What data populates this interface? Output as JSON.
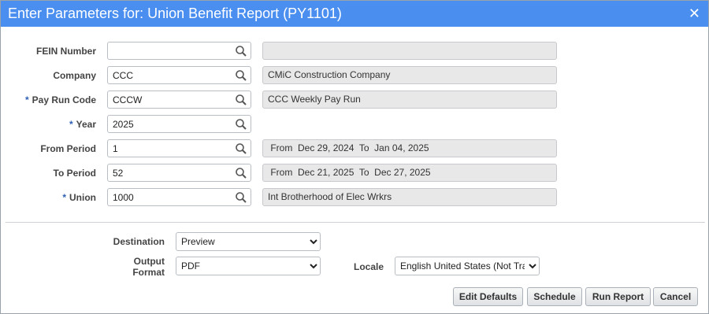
{
  "dialog": {
    "title": "Enter Parameters for: Union Benefit Report (PY1101)",
    "close_label": "✕"
  },
  "fields": [
    {
      "label": "FEIN Number",
      "required": false,
      "value": "",
      "description": ""
    },
    {
      "label": "Company",
      "required": false,
      "value": "CCC",
      "description": "CMiC Construction Company"
    },
    {
      "label": "Pay Run Code",
      "required": true,
      "value": "CCCW",
      "description": "CCC Weekly Pay Run"
    },
    {
      "label": "Year",
      "required": true,
      "value": "2025",
      "description": null
    },
    {
      "label": "From Period",
      "required": false,
      "value": "1",
      "description": " From  Dec 29, 2024  To  Jan 04, 2025"
    },
    {
      "label": "To Period",
      "required": false,
      "value": "52",
      "description": " From  Dec 21, 2025  To  Dec 27, 2025"
    },
    {
      "label": "Union",
      "required": true,
      "value": "1000",
      "description": "Int Brotherhood of Elec Wrkrs"
    }
  ],
  "required_marker": "*",
  "output": {
    "destination_label": "Destination",
    "destination_value": "Preview",
    "format_label_line1": "Output",
    "format_label_line2": "Format",
    "format_value": "PDF",
    "locale_label": "Locale",
    "locale_value": "English United States (Not Tra"
  },
  "buttons": {
    "edit_defaults": "Edit Defaults",
    "schedule": "Schedule",
    "run_report": "Run Report",
    "cancel": "Cancel"
  },
  "icons": {
    "search": "search-icon",
    "close": "close-icon"
  },
  "colors": {
    "title_bar": "#4a8ef0",
    "required_marker": "#2f5fb3",
    "readonly_bg": "#e8e8e8"
  }
}
